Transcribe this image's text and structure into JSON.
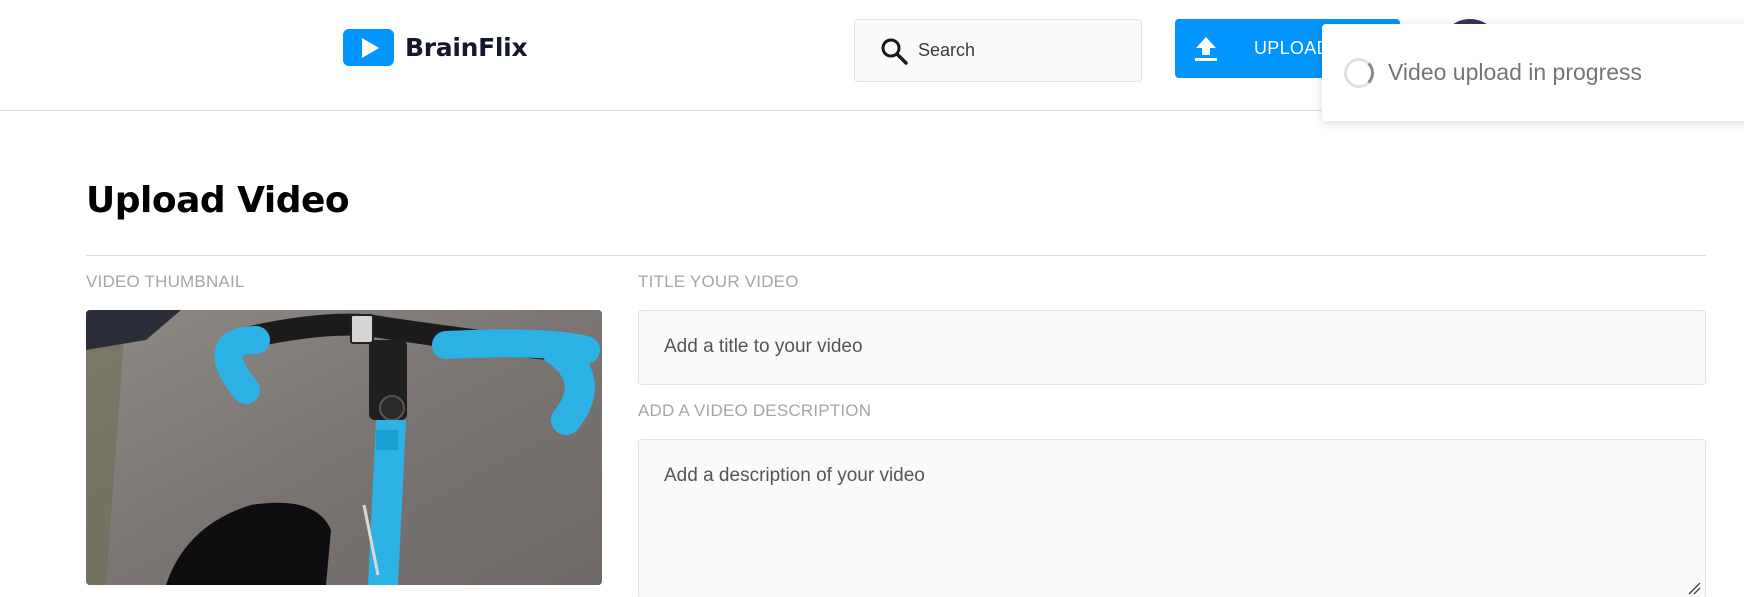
{
  "header": {
    "brand": "BrainFlix",
    "search": {
      "placeholder": "Search"
    },
    "upload_button": "UPLOAD"
  },
  "toast": {
    "message": "Video upload in progress"
  },
  "main": {
    "title": "Upload Video",
    "thumbnail_label": "VIDEO THUMBNAIL",
    "title_label": "TITLE YOUR VIDEO",
    "title_placeholder": "Add a title to your video",
    "description_label": "ADD A VIDEO DESCRIPTION",
    "description_placeholder": "Add a description of your video"
  },
  "colors": {
    "brand_blue": "#0095ff",
    "field_bg": "#fafafa",
    "label_gray": "#a6a6a6",
    "bike_blue": "#2cb2e4"
  },
  "icons": [
    "play-icon",
    "search-icon",
    "upload-icon",
    "spinner-icon",
    "resize-handle-icon"
  ]
}
